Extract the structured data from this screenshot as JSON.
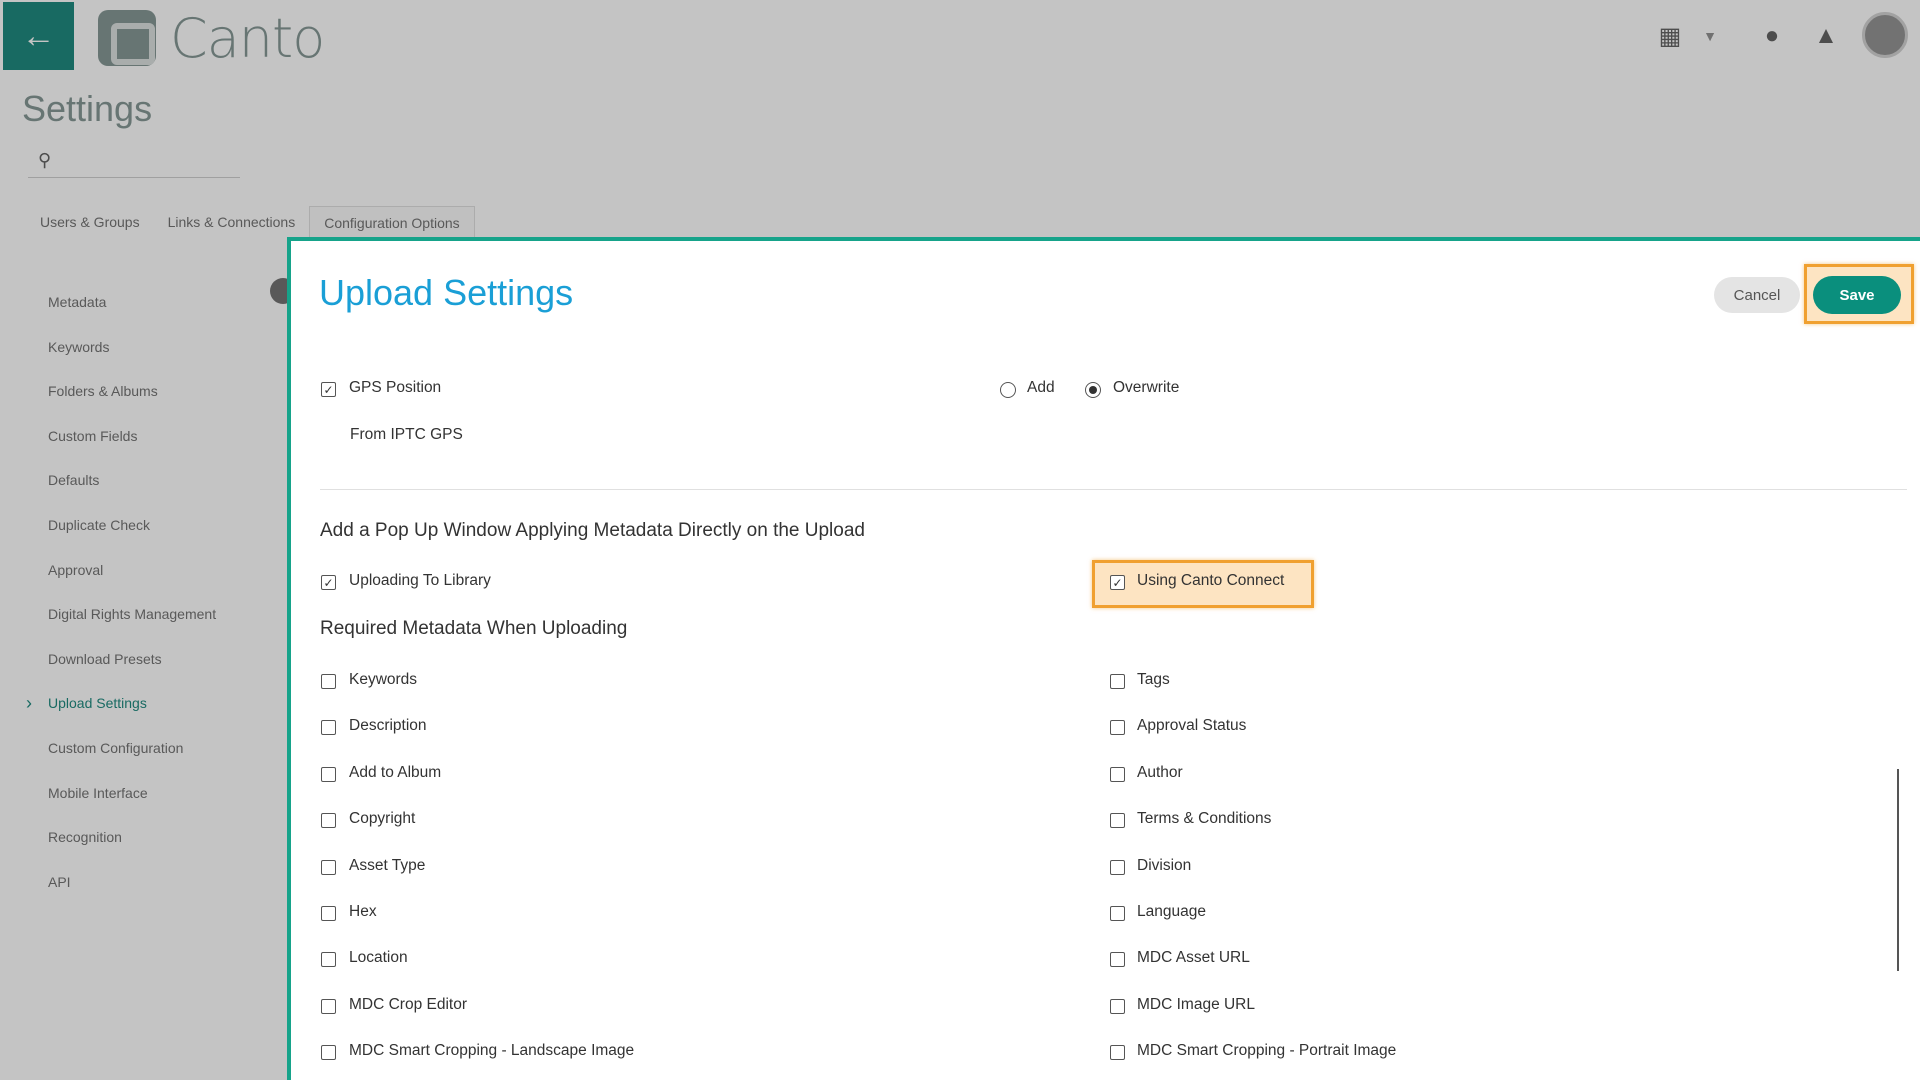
{
  "app": {
    "logo_text": "Canto",
    "page_title": "Settings",
    "search": {
      "placeholder": ""
    },
    "tabs": [
      "Users & Groups",
      "Links & Connections",
      "Configuration Options"
    ],
    "sidebar_items": [
      "Metadata",
      "Keywords",
      "Folders & Albums",
      "Custom Fields",
      "Defaults",
      "Duplicate Check",
      "Approval",
      "Digital Rights Management",
      "Download Presets",
      "Upload Settings",
      "Custom Configuration",
      "Mobile Interface",
      "Recognition",
      "API"
    ],
    "selected_sidebar_item": "Upload Settings"
  },
  "modal": {
    "title": "Upload Settings",
    "cancel_label": "Cancel",
    "save_label": "Save",
    "gps": {
      "label": "GPS Position",
      "checked": true,
      "sub_label": "From IPTC GPS",
      "mode_options": [
        "Add",
        "Overwrite"
      ],
      "selected_mode": "Overwrite"
    },
    "popup_section": {
      "heading": "Add a Pop Up Window Applying Metadata Directly on the Upload",
      "uploading_to_library": {
        "label": "Uploading To Library",
        "checked": true
      },
      "using_canto_connect": {
        "label": "Using Canto Connect",
        "checked": true
      }
    },
    "required_section": {
      "heading": "Required Metadata When Uploading",
      "left_column": [
        "Keywords",
        "Description",
        "Add to Album",
        "Copyright",
        "Asset Type",
        "Hex",
        "Location",
        "MDC Crop Editor",
        "MDC Smart Cropping - Landscape Image"
      ],
      "right_column": [
        "Tags",
        "Approval Status",
        "Author",
        "Terms & Conditions",
        "Division",
        "Language",
        "MDC Asset URL",
        "MDC Image URL",
        "MDC Smart Cropping - Portrait Image"
      ]
    }
  },
  "colors": {
    "accent": "#0a8f7d",
    "title_blue": "#1a9fd6",
    "highlight_border": "#f0a030",
    "highlight_fill": "#fde4c2"
  }
}
